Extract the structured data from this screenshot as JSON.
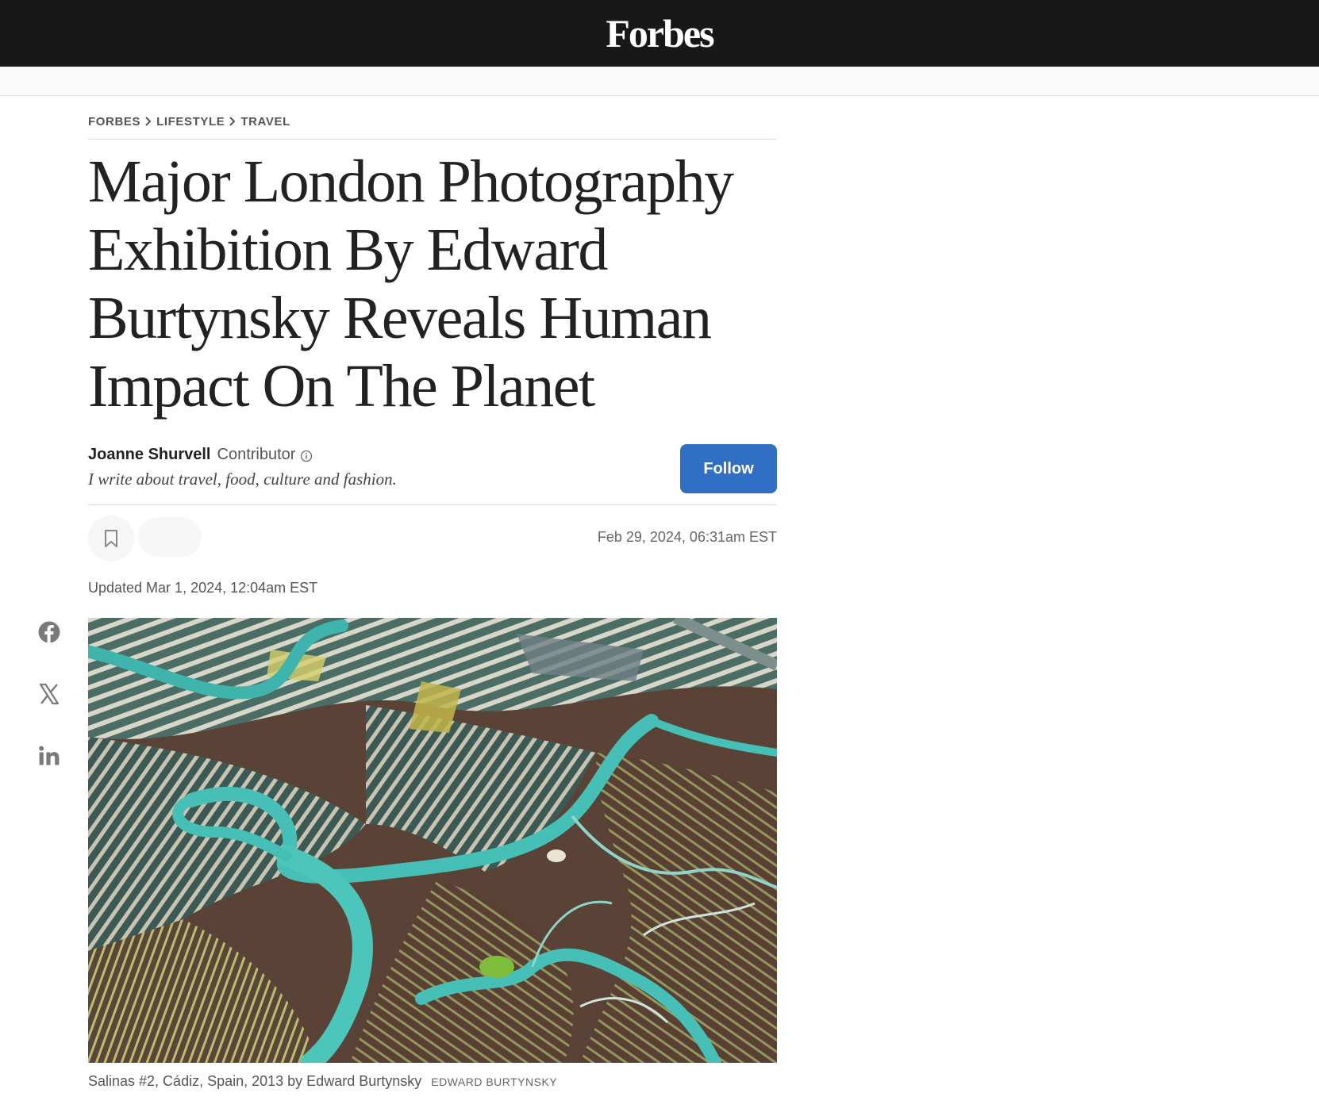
{
  "site": {
    "logo": "Forbes"
  },
  "breadcrumb": [
    "FORBES",
    "LIFESTYLE",
    "TRAVEL"
  ],
  "article": {
    "headline": "Major London Photography Exhibition By Edward Burtynsky Reveals Human Impact On The Planet",
    "author_name": "Joanne Shurvell",
    "author_role": "Contributor",
    "author_bio": "I write about travel, food, culture and fashion.",
    "follow_label": "Follow",
    "published": "Feb 29, 2024, 06:31am EST",
    "updated": "Updated Mar 1, 2024, 12:04am EST"
  },
  "share": {
    "icons": [
      "facebook-icon",
      "x-icon",
      "linkedin-icon"
    ]
  },
  "hero": {
    "caption": "Salinas #2, Cádiz, Spain, 2013 by Edward Burtynsky",
    "credit": "EDWARD BURTYNSKY"
  },
  "colors": {
    "topbar": "#181818",
    "follow_button": "#3070c4",
    "text_primary": "#222222",
    "text_muted": "#555555"
  }
}
